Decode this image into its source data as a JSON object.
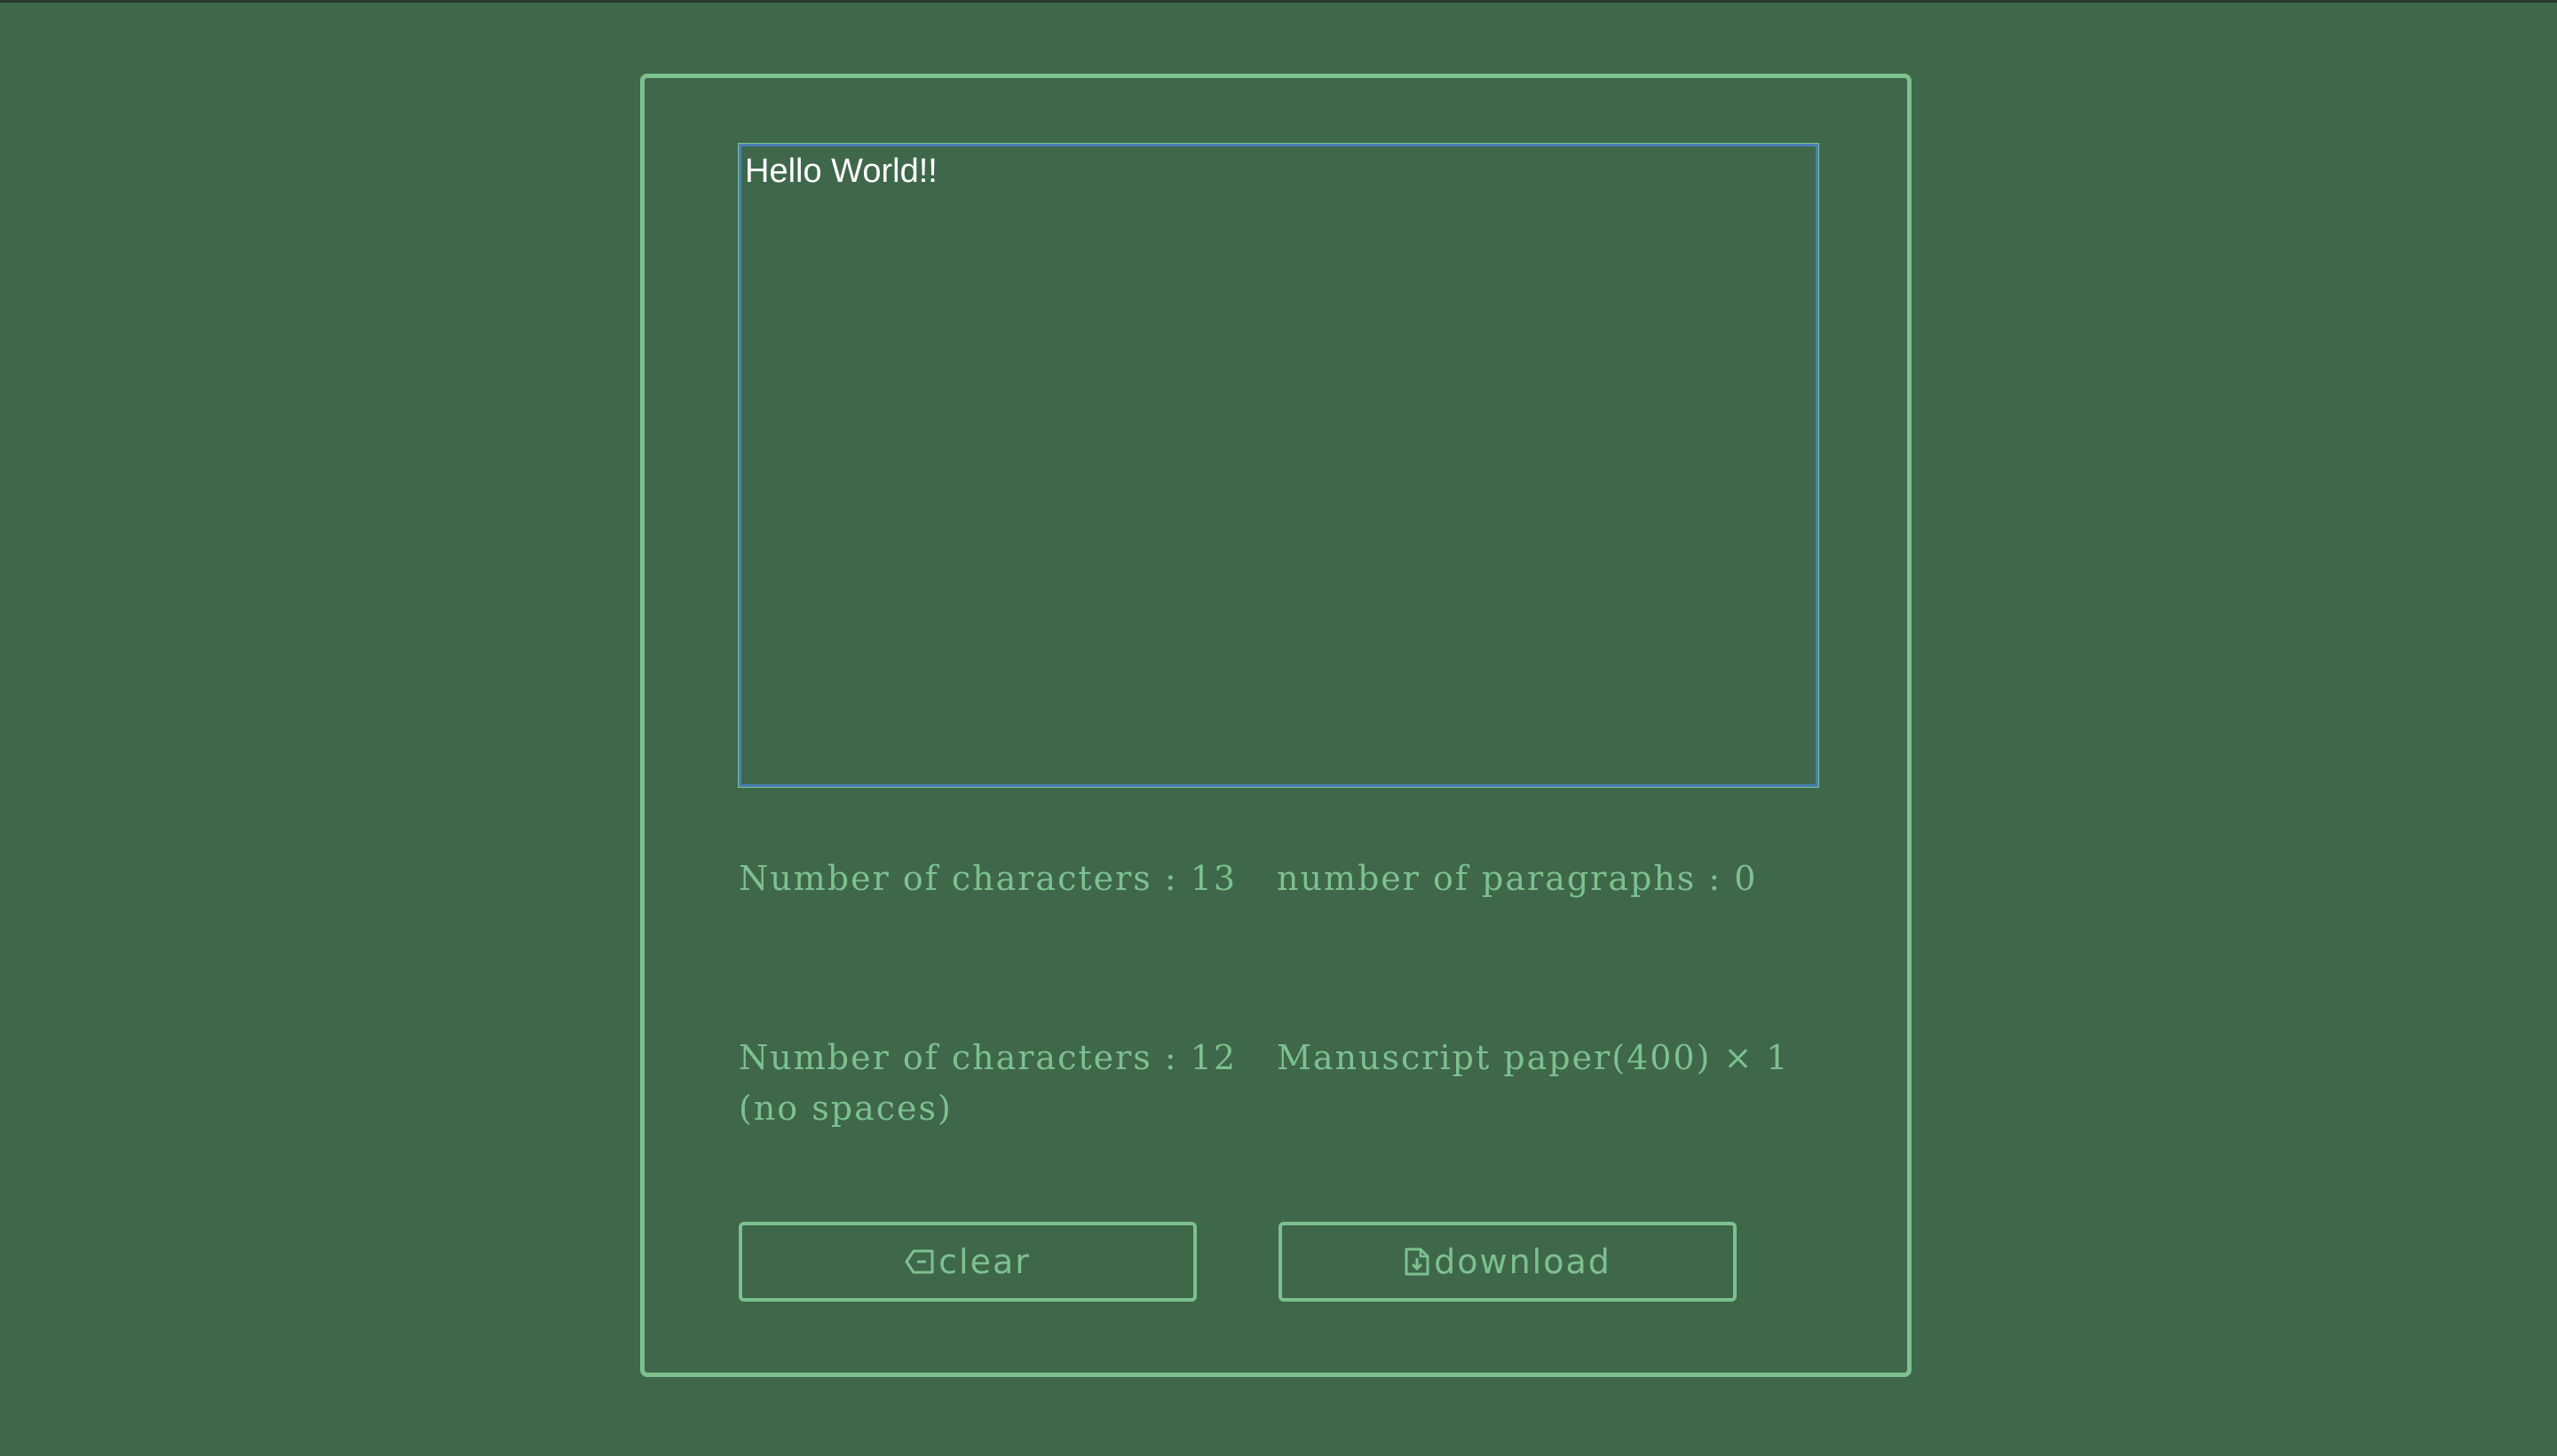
{
  "editor": {
    "text": "Hello World!!"
  },
  "stats": {
    "char_count_label": "Number of characters : 13",
    "paragraphs_label": "number of paragraphs : 0",
    "char_count_no_spaces_label": "Number of characters : 12",
    "char_count_no_spaces_suffix": "(no spaces)",
    "manuscript_label": "Manuscript paper(400) × 1"
  },
  "buttons": {
    "clear_label": "clear",
    "clear_icon": "backspace-icon",
    "download_label": "download",
    "download_icon": "file-download-icon"
  },
  "colors": {
    "background": "#3f674a",
    "accent": "#7cc18e",
    "focus_ring": "#4a7fb8",
    "text": "#ffffff"
  }
}
